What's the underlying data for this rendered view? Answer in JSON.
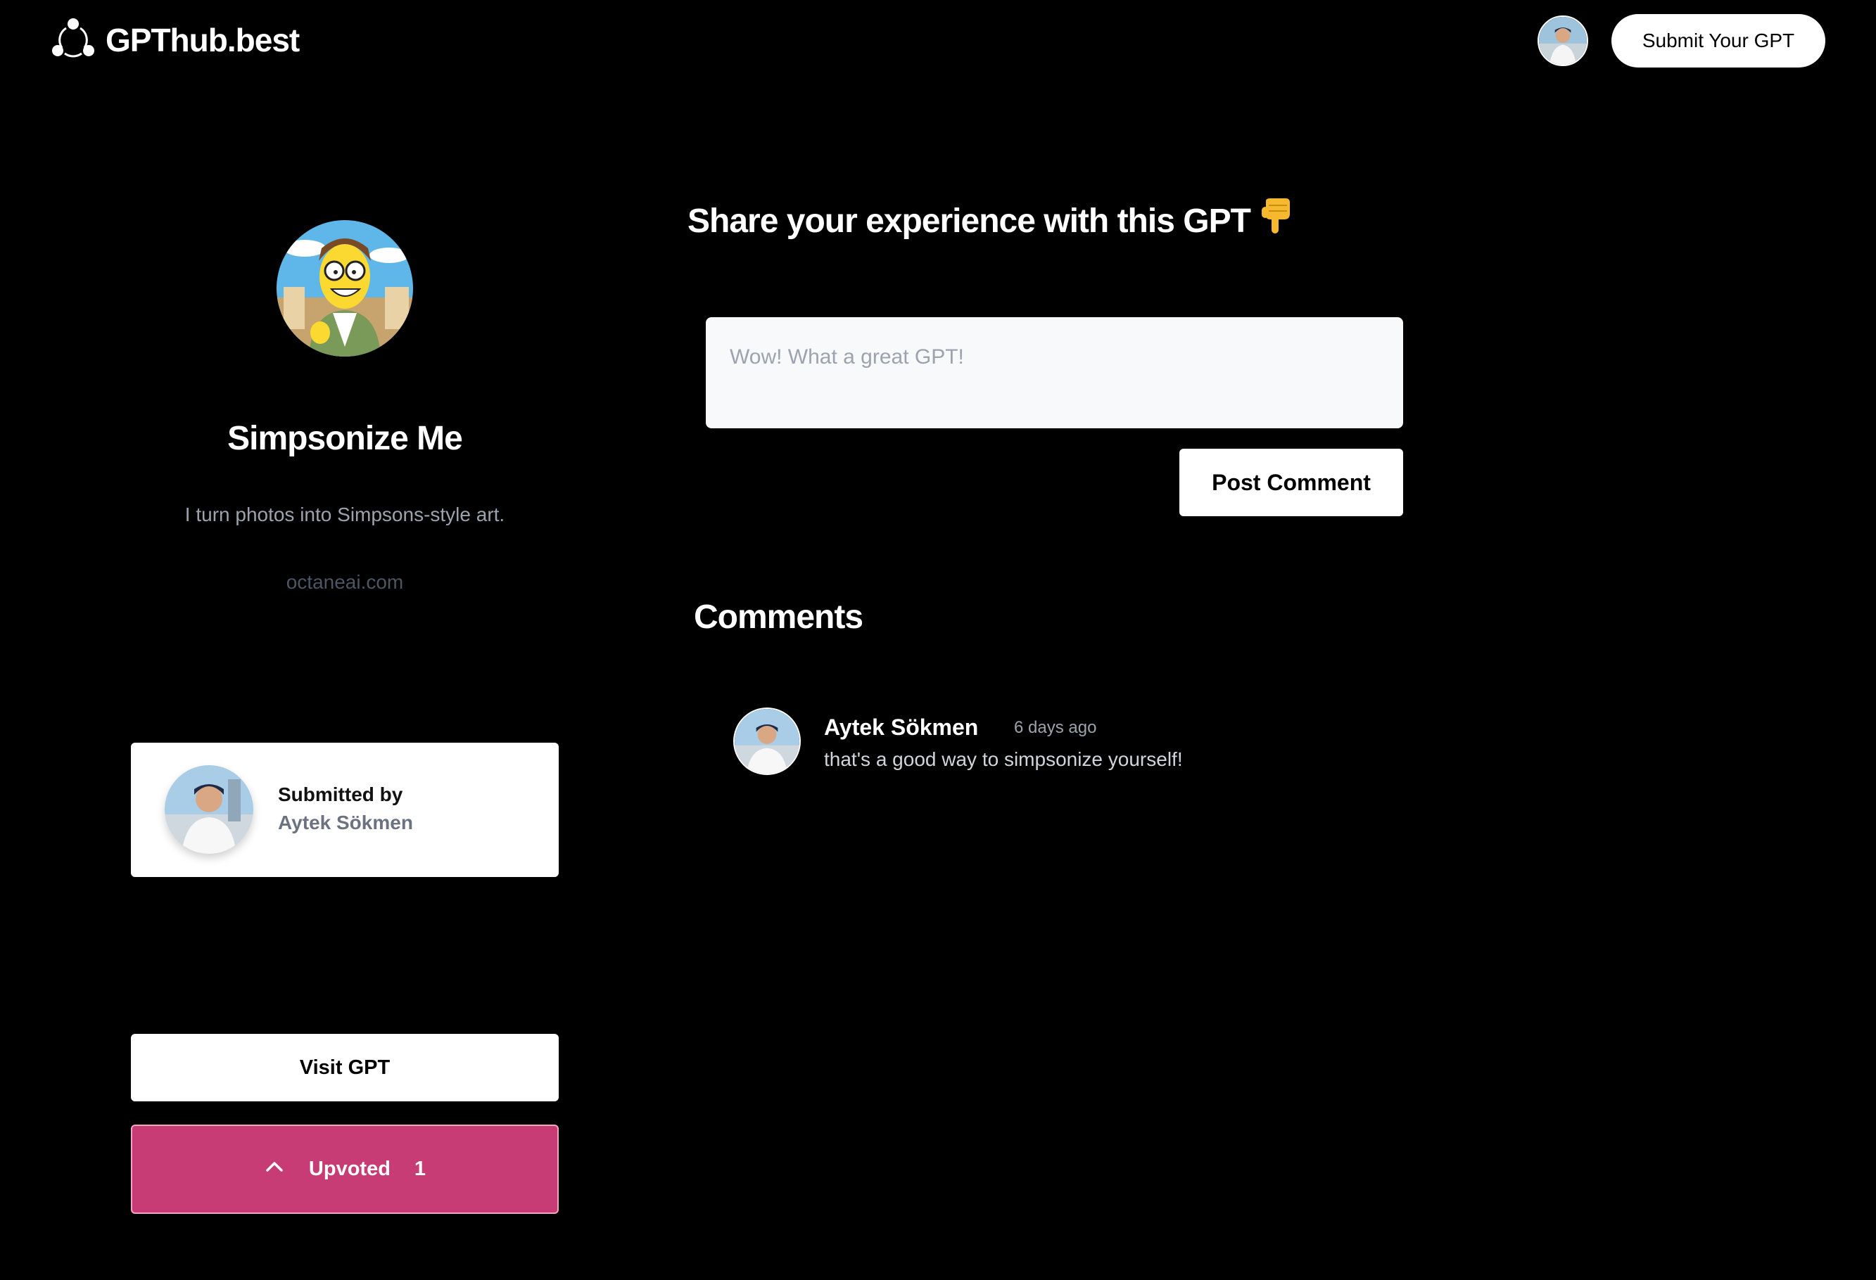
{
  "header": {
    "logo_text": "GPThub.best",
    "logo_icon": "share-nodes-icon",
    "user_avatar": "user-avatar",
    "submit_button": "Submit Your GPT"
  },
  "gpt": {
    "name": "Simpsonize Me",
    "description": "I turn photos into Simpsons-style art.",
    "link": "octaneai.com",
    "avatar": "simpsons-character-avatar"
  },
  "submitted_by": {
    "label": "Submitted by",
    "name": "Aytek Sökmen"
  },
  "actions": {
    "visit_label": "Visit GPT",
    "upvote_label": "Upvoted",
    "upvote_count": "1",
    "upvote_icon": "chevron-up-icon"
  },
  "share": {
    "heading": "Share your experience with this GPT",
    "heading_icon": "pointing-down-hand-icon",
    "placeholder": "Wow! What a great GPT!",
    "post_button": "Post Comment"
  },
  "comments": {
    "heading": "Comments",
    "items": [
      {
        "author": "Aytek Sökmen",
        "time": "6 days ago",
        "text": "that's a good way to simpsonize yourself!"
      }
    ]
  },
  "colors": {
    "background": "#000000",
    "upvote_accent": "#c73c74",
    "muted_text": "#9ca3af"
  }
}
